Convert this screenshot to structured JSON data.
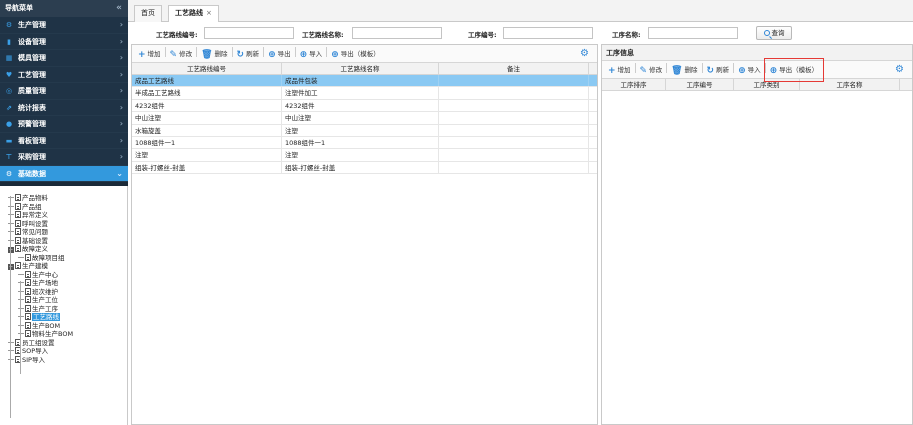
{
  "sidebar": {
    "title": "导航菜单",
    "collapse_icon": "«",
    "menu": [
      {
        "label": "生产管理",
        "icon": "⚙",
        "active": false
      },
      {
        "label": "设备管理",
        "icon": "▮",
        "active": false
      },
      {
        "label": "模具管理",
        "icon": "▦",
        "active": false
      },
      {
        "label": "工艺管理",
        "icon": "♥",
        "active": false
      },
      {
        "label": "质量管理",
        "icon": "◎",
        "active": false
      },
      {
        "label": "统计报表",
        "icon": "⇗",
        "active": false
      },
      {
        "label": "预警管理",
        "icon": "●",
        "active": false
      },
      {
        "label": "看板管理",
        "icon": "▬",
        "active": false
      },
      {
        "label": "采购管理",
        "icon": "⊤",
        "active": false
      },
      {
        "label": "基础数据",
        "icon": "⚙",
        "active": true
      }
    ],
    "tree": [
      {
        "label": "产品物料",
        "level": 0,
        "type": "leaf"
      },
      {
        "label": "产品组",
        "level": 0,
        "type": "leaf"
      },
      {
        "label": "异常定义",
        "level": 0,
        "type": "leaf"
      },
      {
        "label": "呼叫设置",
        "level": 0,
        "type": "leaf"
      },
      {
        "label": "常见问题",
        "level": 0,
        "type": "leaf"
      },
      {
        "label": "基础设置",
        "level": 0,
        "type": "leaf"
      },
      {
        "label": "故障定义",
        "level": 0,
        "type": "folder"
      },
      {
        "label": "故障项目组",
        "level": 1,
        "type": "leaf"
      },
      {
        "label": "生产建模",
        "level": 0,
        "type": "folder"
      },
      {
        "label": "生产中心",
        "level": 1,
        "type": "leaf"
      },
      {
        "label": "生产场地",
        "level": 1,
        "type": "leaf"
      },
      {
        "label": "班次维护",
        "level": 1,
        "type": "leaf"
      },
      {
        "label": "生产工位",
        "level": 1,
        "type": "leaf"
      },
      {
        "label": "生产工序",
        "level": 1,
        "type": "leaf"
      },
      {
        "label": "工艺路线",
        "level": 1,
        "type": "leaf",
        "selected": true
      },
      {
        "label": "生产BOM",
        "level": 1,
        "type": "leaf"
      },
      {
        "label": "物料生产BOM",
        "level": 1,
        "type": "leaf"
      },
      {
        "label": "员工组设置",
        "level": 0,
        "type": "leaf"
      },
      {
        "label": "SOP导入",
        "level": 0,
        "type": "leaf"
      },
      {
        "label": "SIP导入",
        "level": 0,
        "type": "leaf"
      }
    ]
  },
  "tabs": [
    {
      "label": "首页",
      "active": false
    },
    {
      "label": "工艺路线",
      "active": true,
      "close": "×"
    }
  ],
  "filter": {
    "route_code_label": "工艺路线编号:",
    "route_name_label": "工艺路线名称:",
    "process_code_label": "工序编号:",
    "process_name_label": "工序名称:",
    "query_label": "查询"
  },
  "left_panel": {
    "toolbar": [
      {
        "label": "增加",
        "icon": "+"
      },
      {
        "label": "修改",
        "icon": "✎"
      },
      {
        "label": "删除",
        "icon": "🗑"
      },
      {
        "label": "刷新",
        "icon": "↻"
      },
      {
        "label": "导出",
        "icon": "⊕"
      },
      {
        "label": "导入",
        "icon": "⊕"
      },
      {
        "label": "导出（模板）",
        "icon": "⊕"
      }
    ],
    "columns": [
      "工艺路线编号",
      "工艺路线名称",
      "备注"
    ],
    "rows": [
      [
        "成品工艺路线",
        "成品件包装",
        ""
      ],
      [
        "半成品工艺路线",
        "注塑件加工",
        ""
      ],
      [
        "4232组件",
        "4232组件",
        ""
      ],
      [
        "中山注塑",
        "中山注塑",
        ""
      ],
      [
        "水箱旋盖",
        "注塑",
        ""
      ],
      [
        "1088组件一1",
        "1088组件一1",
        ""
      ],
      [
        "注塑",
        "注塑",
        ""
      ],
      [
        "组装-打螺丝-封盖",
        "组装-打螺丝-封盖",
        ""
      ]
    ]
  },
  "right_panel": {
    "title": "工序信息",
    "toolbar": [
      {
        "label": "增加",
        "icon": "+"
      },
      {
        "label": "修改",
        "icon": "✎"
      },
      {
        "label": "删除",
        "icon": "🗑"
      },
      {
        "label": "刷新",
        "icon": "↻"
      },
      {
        "label": "导入",
        "icon": "⊕"
      },
      {
        "label": "导出（模板）",
        "icon": "⊕",
        "highlight": true
      }
    ],
    "columns": [
      "工序排序",
      "工序编号",
      "工序类别",
      "工序名称"
    ]
  },
  "colors": {
    "sidebar_bg": "#1b2a38",
    "accent": "#3399dd",
    "selected_row": "#8ac9f3",
    "highlight_box": "#e53935"
  }
}
